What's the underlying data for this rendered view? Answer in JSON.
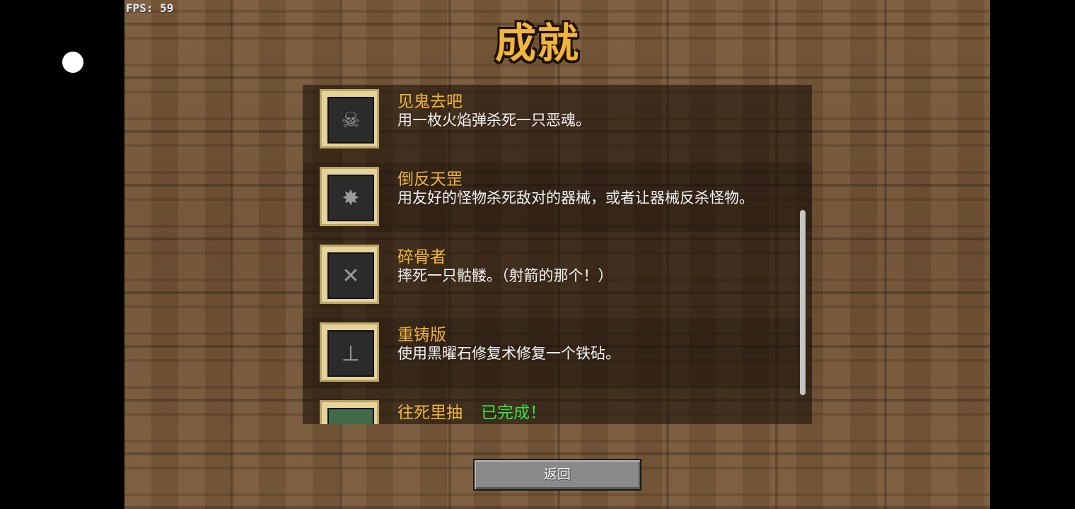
{
  "hud": {
    "fps": "FPS: 59"
  },
  "screen": {
    "title": "成就"
  },
  "achievements": [
    {
      "title": "见鬼去吧",
      "desc": "用一枚火焰弹杀死一只恶魂。",
      "icon": "ghast-icon",
      "status": ""
    },
    {
      "title": "倒反天罡",
      "desc": "用友好的怪物杀死敌对的器械，或者让器械反杀怪物。",
      "icon": "golem-icon",
      "status": ""
    },
    {
      "title": "碎骨者",
      "desc": "摔死一只骷髅。（射箭的那个！）",
      "icon": "bone-icon",
      "status": ""
    },
    {
      "title": "重铸版",
      "desc": "使用黑曜石修复术修复一个铁砧。",
      "icon": "anvil-icon",
      "status": ""
    },
    {
      "title": "往死里抽",
      "desc": "",
      "icon": "box-icon",
      "status": "已完成！"
    }
  ],
  "buttons": {
    "back": "返回"
  }
}
